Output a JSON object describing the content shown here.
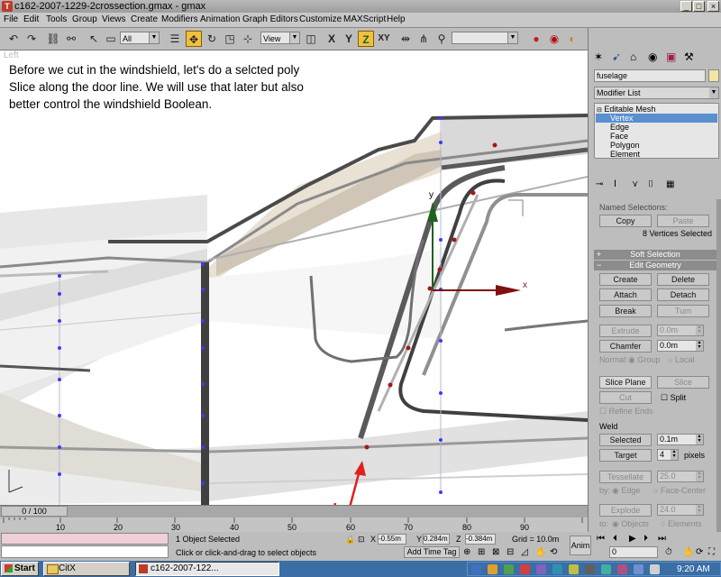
{
  "window": {
    "title": "c162-2007-1229-2crossection.gmax - gmax",
    "minimize": "_",
    "maximize": "□",
    "close": "×"
  },
  "menu": [
    "File",
    "Edit",
    "Tools",
    "Group",
    "Views",
    "Create",
    "Modifiers",
    "Animation",
    "Graph Editors",
    "Customize",
    "MAXScript",
    "Help"
  ],
  "toolbar": {
    "selection_filter": "All",
    "ref_coord": "View",
    "axis_x": "X",
    "axis_y": "Y",
    "axis_z": "Z",
    "axis_xy": "XY"
  },
  "viewport": {
    "label": "Left",
    "note": "Before we cut in the windshield, let's do a selcted poly Slice along the door line.  We will use that later but also better control the windshield Boolean.",
    "axis_y": "y",
    "axis_x": "x"
  },
  "panel": {
    "object_name": "fuselage",
    "modifier_list": "Modifier List",
    "stack": {
      "root": "Editable Mesh",
      "items": [
        "Vertex",
        "Edge",
        "Face",
        "Polygon",
        "Element"
      ],
      "selected": "Vertex"
    },
    "named_selections": "Named Selections:",
    "copy": "Copy",
    "paste": "Paste",
    "vertices_selected": "8 Vertices Selected",
    "soft_selection": "Soft Selection",
    "edit_geometry": "Edit Geometry",
    "create": "Create",
    "delete": "Delete",
    "attach": "Attach",
    "detach": "Detach",
    "break": "Break",
    "turn": "Turn",
    "extrude": "Extrude",
    "extrude_val": "0.0m",
    "chamfer": "Chamfer",
    "chamfer_val": "0.0m",
    "normal": "Normal:",
    "group": "Group",
    "local": "Local",
    "slice_plane": "Slice Plane",
    "slice": "Slice",
    "cut": "Cut",
    "split": "Split",
    "refine_ends": "Refine Ends",
    "weld": "Weld",
    "selected": "Selected",
    "selected_val": "0.1m",
    "target": "Target",
    "target_val": "4",
    "pixels": "pixels",
    "tessellate": "Tessellate",
    "tessellate_val": "25.0",
    "by": "by:",
    "edge": "Edge",
    "face_center": "Face-Center",
    "explode": "Explode",
    "explode_val": "24.0",
    "to": "to:",
    "objects": "Objects",
    "elements": "Elements"
  },
  "timeline": {
    "frame": "0 / 100",
    "ticks": [
      "10",
      "20",
      "30",
      "40",
      "50",
      "60",
      "70",
      "80",
      "90"
    ]
  },
  "status": {
    "selected": "1 Object Selected",
    "prompt": "Click or click-and-drag to select objects",
    "x_label": "X",
    "x": "-0.55m",
    "y_label": "Y",
    "y": "0.284m",
    "z_label": "Z",
    "z": "-0.384m",
    "grid": "Grid = 10.0m",
    "add_time_tag": "Add Time Tag",
    "anim": "Anim",
    "frame_field": "0"
  },
  "taskbar": {
    "start": "Start",
    "task1": "CitX",
    "task2": "c162-2007-122...",
    "clock": "9:20 AM"
  },
  "colors": {
    "accent_selected": "#5a8fd0",
    "rollout": "#8c8c8c",
    "vertex": "#3a3aff",
    "arrow": "#e02020",
    "gizmo_y": "#206020",
    "gizmo_x": "#801010"
  }
}
